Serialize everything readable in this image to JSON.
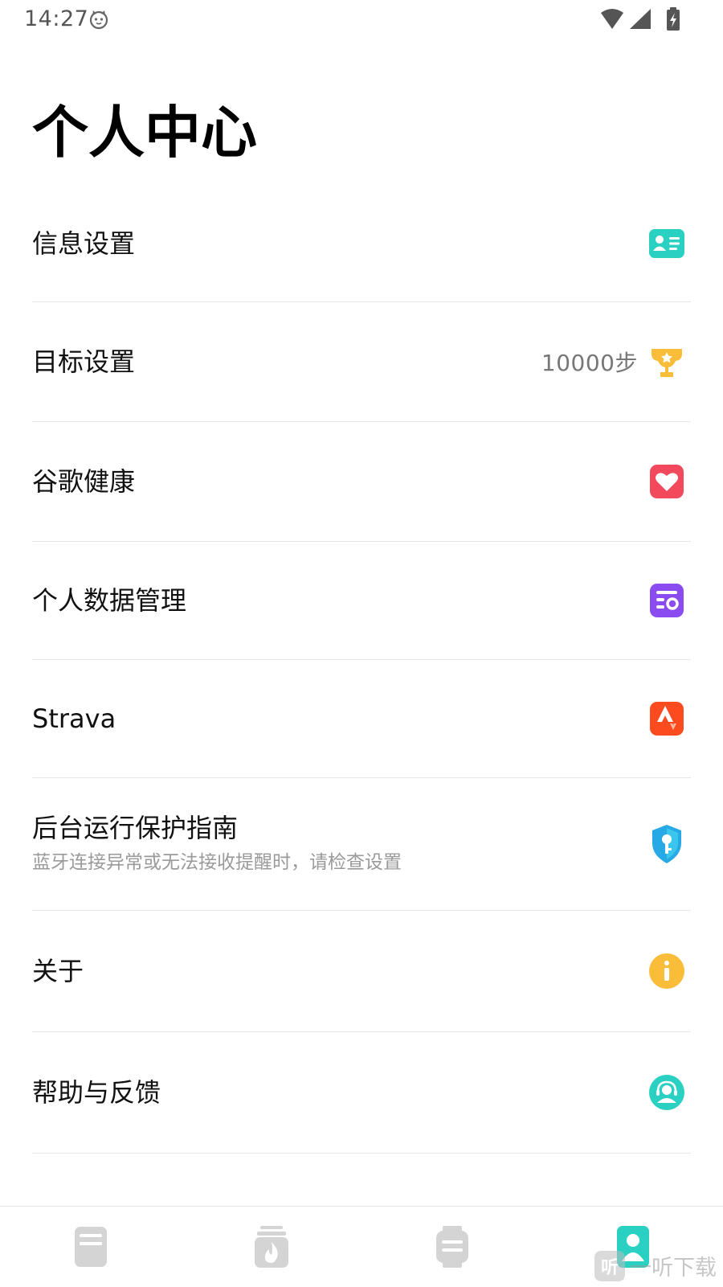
{
  "status_bar": {
    "time": "14:27"
  },
  "page": {
    "title": "个人中心"
  },
  "menu": [
    {
      "label": "信息设置",
      "icon": "profile-card-icon",
      "color": "#2ad1c3"
    },
    {
      "label": "目标设置",
      "value": "10000步",
      "icon": "trophy-icon",
      "color": "#f9bd3a"
    },
    {
      "label": "谷歌健康",
      "icon": "heart-icon",
      "color": "#f2495d"
    },
    {
      "label": "个人数据管理",
      "icon": "data-management-icon",
      "color": "#8a4cf0"
    },
    {
      "label": "Strava",
      "icon": "strava-icon",
      "color": "#fc4c1f"
    },
    {
      "label": "后台运行保护指南",
      "subtitle": "蓝牙连接异常或无法接收提醒时，请检查设置",
      "icon": "shield-key-icon",
      "color": "#27a9e6"
    },
    {
      "label": "关于",
      "icon": "info-icon",
      "color": "#f9bd3a"
    },
    {
      "label": "帮助与反馈",
      "icon": "customer-service-icon",
      "color": "#2ad1c3"
    }
  ],
  "bottom_nav": {
    "tabs": [
      {
        "icon": "dashboard-icon",
        "active": false
      },
      {
        "icon": "workout-icon",
        "active": false
      },
      {
        "icon": "watch-icon",
        "active": false
      },
      {
        "icon": "profile-icon",
        "active": true
      }
    ],
    "active_color": "#2ad1c3",
    "inactive_color": "#d4d4d4"
  },
  "watermark": {
    "badge": "听",
    "text": "一听下载"
  }
}
